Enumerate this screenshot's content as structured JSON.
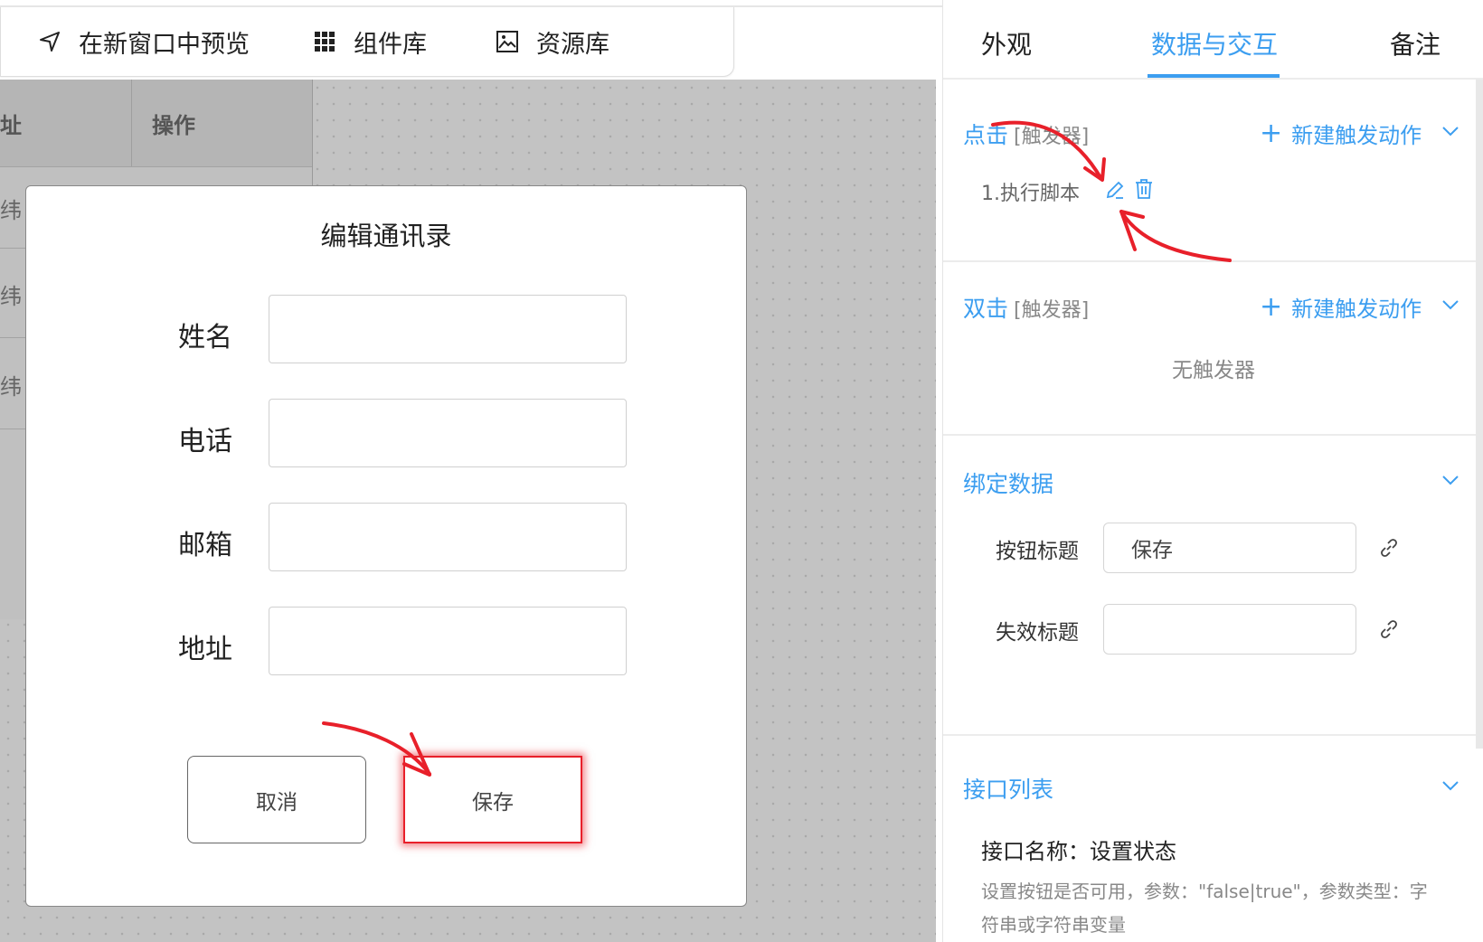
{
  "toolbar": {
    "preview_label": "在新窗口中预览",
    "components_label": "组件库",
    "assets_label": "资源库"
  },
  "bg_table": {
    "headers": [
      "址",
      "操作"
    ],
    "rows": [
      "纬",
      "纬",
      "纬"
    ]
  },
  "modal": {
    "title": "编辑通讯录",
    "fields": [
      {
        "label": "姓名",
        "value": ""
      },
      {
        "label": "电话",
        "value": ""
      },
      {
        "label": "邮箱",
        "value": ""
      },
      {
        "label": "地址",
        "value": ""
      }
    ],
    "cancel_label": "取消",
    "save_label": "保存"
  },
  "panel": {
    "tabs": [
      "外观",
      "数据与交互",
      "备注"
    ],
    "active_tab": 1,
    "click_section": {
      "title": "点击",
      "tag": "[触发器]",
      "add_label": "新建触发动作",
      "action": "1.执行脚本"
    },
    "dblclick_section": {
      "title": "双击",
      "tag": "[触发器]",
      "add_label": "新建触发动作",
      "empty_text": "无触发器"
    },
    "bind_section": {
      "title": "绑定数据",
      "rows": [
        {
          "label": "按钮标题",
          "value": "保存"
        },
        {
          "label": "失效标题",
          "value": ""
        }
      ]
    },
    "api_section": {
      "title": "接口列表",
      "api_name": "接口名称：设置状态",
      "api_desc_1": "设置按钮是否可用，参数：\"false|true\"，参数类型：字",
      "api_desc_2": "符串或字符串变量"
    }
  },
  "colors": {
    "accent": "#3c9ef0",
    "annotation_red": "#e8202a"
  }
}
